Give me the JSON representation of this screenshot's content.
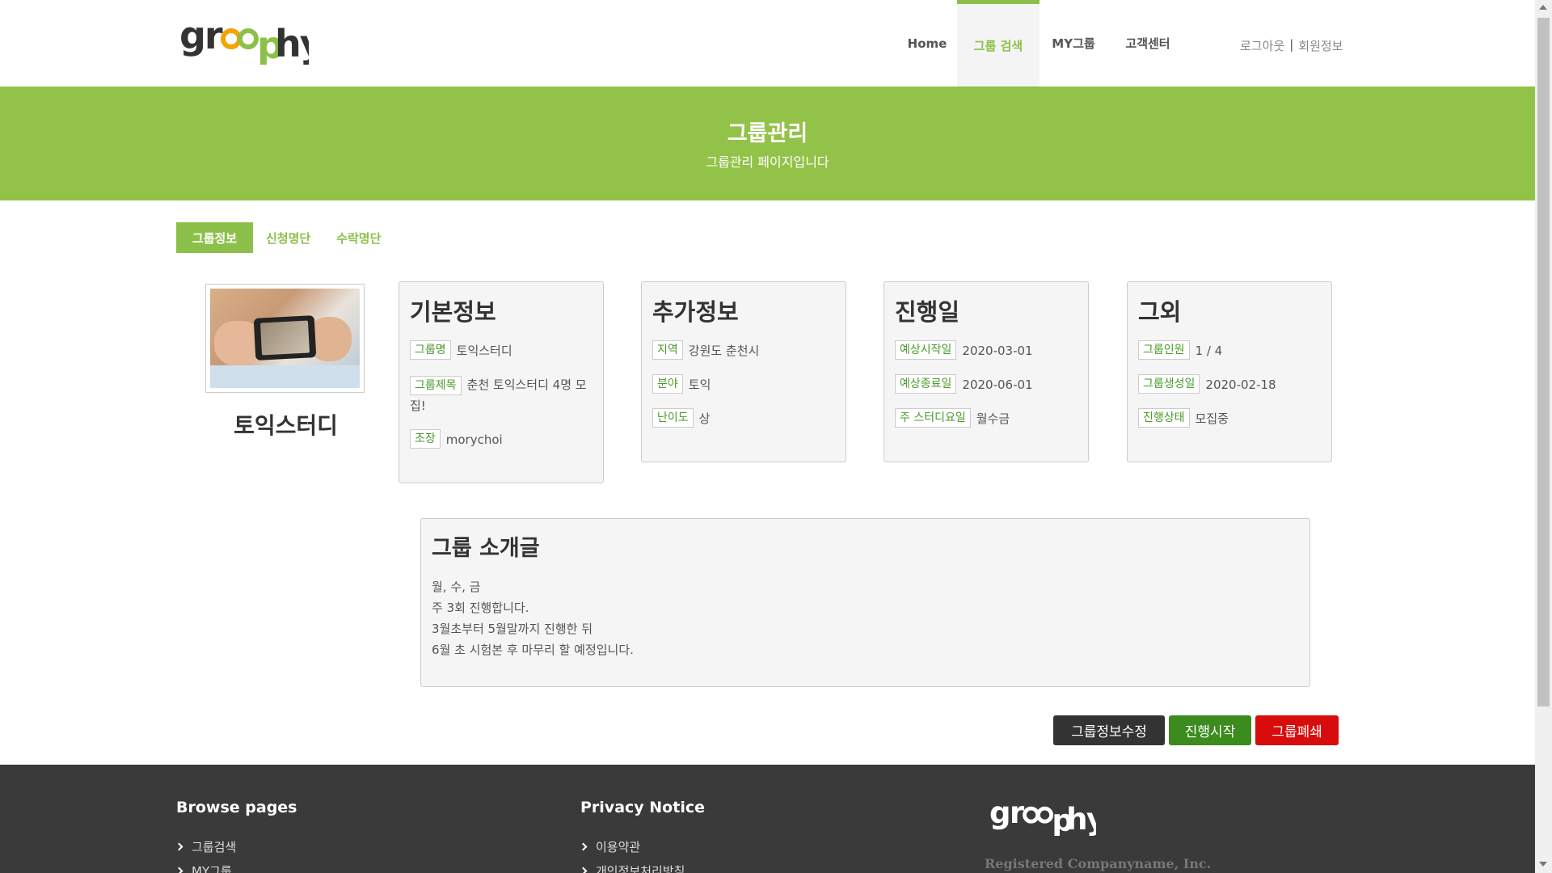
{
  "brand": {
    "logo_text": "groophy",
    "accent": "#8dc04a"
  },
  "nav": {
    "home": "Home",
    "group_search": "그룹 검색",
    "my_group": "MY그룹",
    "customer_center": "고객센터",
    "logout": "로그아웃",
    "separator": "|",
    "member_info": "회원정보"
  },
  "banner": {
    "title": "그룹관리",
    "subtitle": "그룹관리 페이지입니다"
  },
  "tabs": [
    {
      "label": "그룹정보"
    },
    {
      "label": "신청명단"
    },
    {
      "label": "수락명단"
    }
  ],
  "group": {
    "name": "토익스터디"
  },
  "cards": {
    "basic": {
      "title": "기본정보",
      "group_name_label": "그룹명",
      "group_name_value": "토익스터디",
      "group_title_label": "그룹제목",
      "group_title_value": "춘천 토익스터디 4명 모집!",
      "leader_label": "조장",
      "leader_value": "morychoi"
    },
    "extra": {
      "title": "추가정보",
      "region_label": "지역",
      "region_value": "강원도 춘천시",
      "field_label": "분야",
      "field_value": "토익",
      "difficulty_label": "난이도",
      "difficulty_value": "상"
    },
    "schedule": {
      "title": "진행일",
      "start_label": "예상시작일",
      "start_value": "2020-03-01",
      "end_label": "예상종료일",
      "end_value": "2020-06-01",
      "days_label": "주 스터디요일",
      "days_value": "월수금"
    },
    "etc": {
      "title": "그외",
      "members_label": "그룹인원",
      "members_value": "1 / 4",
      "created_label": "그룹생성일",
      "created_value": "2020-02-18",
      "status_label": "진행상태",
      "status_value": "모집중"
    }
  },
  "intro": {
    "title": "그룹 소개글",
    "lines": [
      "월, 수, 금",
      "주 3회 진행합니다.",
      "3월초부터 5월말까지 진행한 뒤",
      "6월 초 시험본 후 마무리 할 예정입니다."
    ]
  },
  "buttons": {
    "edit": "그룹정보수정",
    "start": "진행시작",
    "close": "그룹폐쇄"
  },
  "footer": {
    "browse_title": "Browse pages",
    "browse_links": [
      "그룹검색",
      "MY그룹"
    ],
    "privacy_title": "Privacy Notice",
    "privacy_links": [
      "이용약관",
      "개인정보처리방침"
    ],
    "company": "Registered Companyname, Inc."
  }
}
